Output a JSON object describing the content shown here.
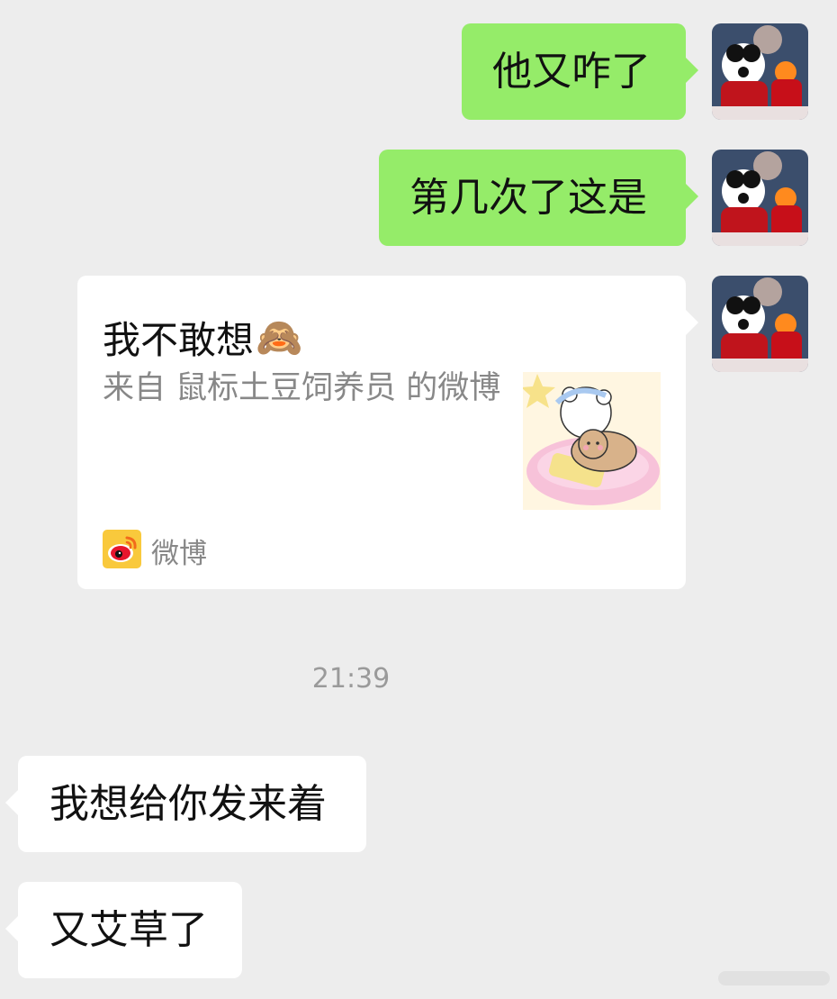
{
  "messages": [
    {
      "text": "他又咋了"
    },
    {
      "text": "第几次了这是"
    },
    {
      "card": {
        "title": "我不敢想",
        "emoji": "🙈",
        "description": "来自 鼠标土豆饲养员 的微博",
        "source_label": "微博"
      }
    },
    {
      "text": "我想给你发来着"
    },
    {
      "text": "又艾草了"
    }
  ],
  "timestamp": "21:39",
  "colors": {
    "background": "#ededed",
    "outgoing_bubble": "#95ec69",
    "incoming_bubble": "#ffffff",
    "meta_text": "#888888"
  }
}
